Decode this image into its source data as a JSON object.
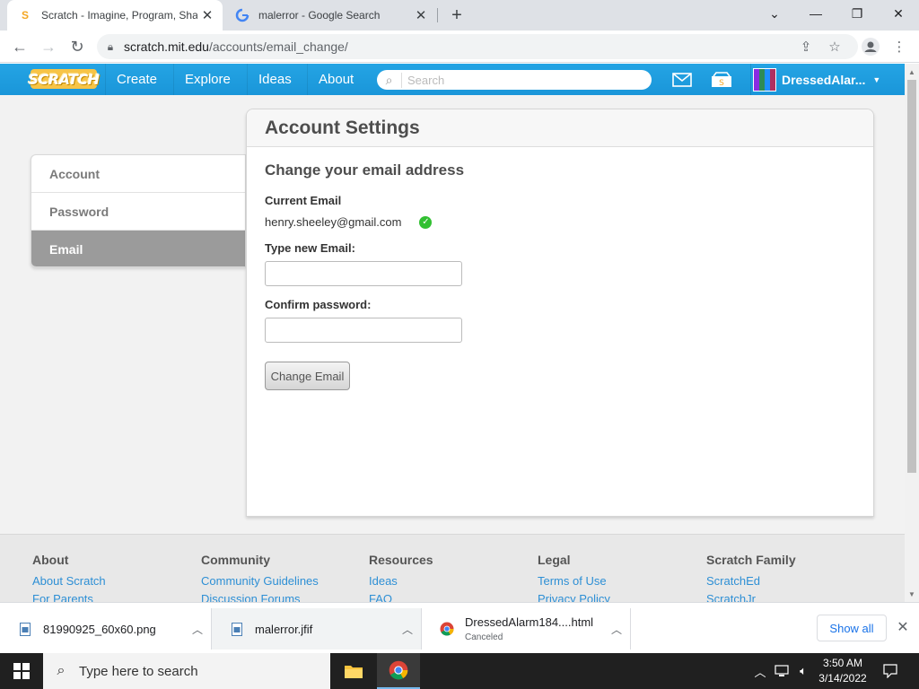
{
  "browser": {
    "tabs": [
      {
        "title": "Scratch - Imagine, Program, Share",
        "active": true,
        "favicon": "scratch-cat-icon"
      },
      {
        "title": "malerror - Google Search",
        "active": false,
        "favicon": "google-icon"
      }
    ],
    "address": {
      "host": "scratch.mit.edu",
      "path": "/accounts/email_change/"
    }
  },
  "scratch_nav": {
    "logo": "SCRATCH",
    "links": [
      "Create",
      "Explore",
      "Ideas",
      "About"
    ],
    "search_placeholder": "Search",
    "username": "DressedAlar..."
  },
  "sidebar": {
    "items": [
      {
        "label": "Account",
        "selected": false
      },
      {
        "label": "Password",
        "selected": false
      },
      {
        "label": "Email",
        "selected": true
      }
    ]
  },
  "settings": {
    "title": "Account Settings",
    "heading": "Change your email address",
    "current_email_label": "Current Email",
    "current_email": "henry.sheeley@gmail.com",
    "new_email_label": "Type new Email:",
    "new_email_value": "",
    "confirm_password_label": "Confirm password:",
    "confirm_password_value": "",
    "submit_label": "Change Email"
  },
  "footer": {
    "columns": [
      {
        "heading": "About",
        "links": [
          "About Scratch",
          "For Parents"
        ]
      },
      {
        "heading": "Community",
        "links": [
          "Community Guidelines",
          "Discussion Forums"
        ]
      },
      {
        "heading": "Resources",
        "links": [
          "Ideas",
          "FAQ"
        ]
      },
      {
        "heading": "Legal",
        "links": [
          "Terms of Use",
          "Privacy Policy"
        ]
      },
      {
        "heading": "Scratch Family",
        "links": [
          "ScratchEd",
          "ScratchJr"
        ]
      }
    ]
  },
  "downloads": {
    "items": [
      {
        "name": "81990925_60x60.png",
        "status": ""
      },
      {
        "name": "malerror.jfif",
        "status": ""
      },
      {
        "name": "DressedAlarm184....html",
        "status": "Canceled"
      }
    ],
    "show_all": "Show all"
  },
  "taskbar": {
    "search_placeholder": "Type here to search",
    "time": "3:50 AM",
    "date": "3/14/2022"
  },
  "colors": {
    "scratch_blue": "#1aa0e6",
    "link_blue": "#2d8fd5",
    "check_green": "#32c032"
  }
}
